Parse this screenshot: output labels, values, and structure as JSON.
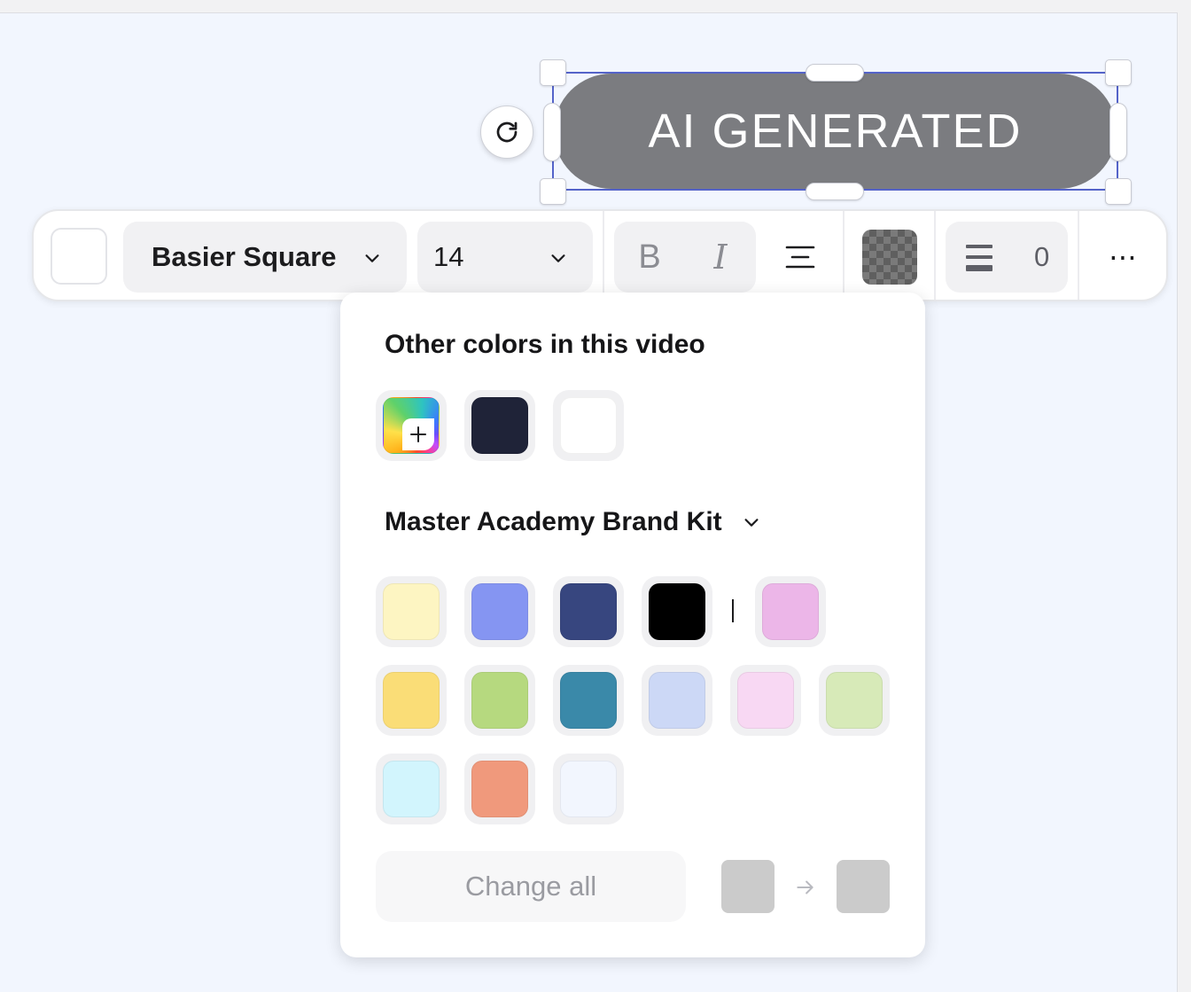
{
  "element": {
    "text": "AI GENERATED"
  },
  "toolbar": {
    "font_family": "Basier Square",
    "font_size": "14",
    "bold_label": "B",
    "italic_label": "I",
    "spacing_value": "0",
    "more_label": "⋯"
  },
  "popover": {
    "other_colors_title": "Other colors in this video",
    "other_colors": [
      "rainbow-add",
      "#1f2338",
      "#ffffff"
    ],
    "brand_kit_title": "Master Academy Brand Kit",
    "brand_colors_row1": [
      "#fdf5c2",
      "#8595f2",
      "#37467f",
      "#000000"
    ],
    "brand_colors_row1_after": [
      "#ecb6e8"
    ],
    "brand_colors_row2": [
      "#fadd77",
      "#b6d97f",
      "#3a89a9",
      "#ccd8f6",
      "#f8d8f3",
      "#d7eab8"
    ],
    "brand_colors_row3": [
      "#d2f5fd",
      "#f0997c",
      "#f2f6fe"
    ],
    "change_all_label": "Change all",
    "from_color": "#cbcbcb",
    "to_color": "#cbcbcb"
  },
  "icons": {
    "rotate": "rotate-icon",
    "chevron": "chevron-down-icon",
    "align": "align-center-icon",
    "spacing": "line-spacing-icon",
    "plus": "plus-icon",
    "arrow": "arrow-right-icon"
  }
}
